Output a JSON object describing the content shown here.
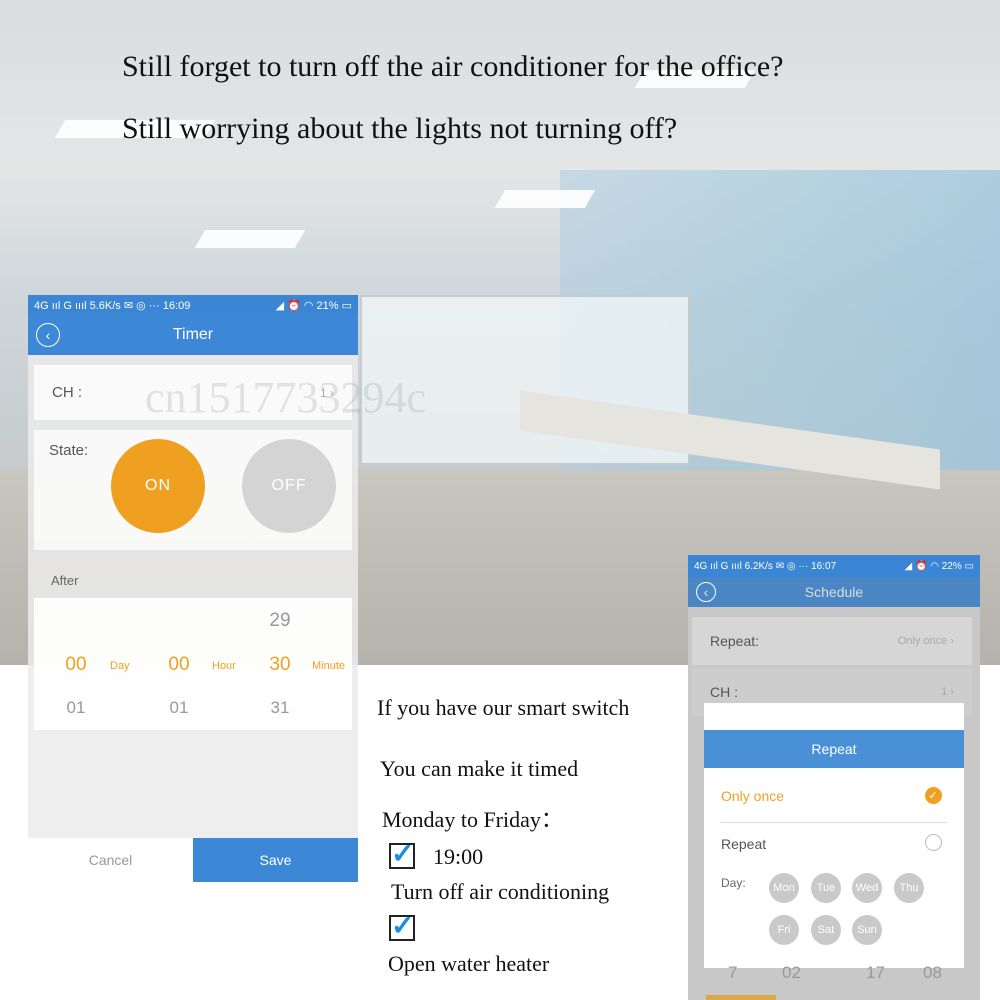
{
  "headlines": [
    "Still forget to turn off the air conditioner for the office?",
    "Still worrying about the lights not turning off?"
  ],
  "watermark": "cn1517733294c",
  "timer_phone": {
    "status": {
      "left": "4G ııl G ıııl 5.6K/s ✉ ◎ ··· 16:09",
      "right": "◢ ⏰ ◠ 21% ▭"
    },
    "title": "Timer",
    "ch_label": "CH :",
    "ch_value": "1 ›",
    "state_label": "State:",
    "on": "ON",
    "off": "OFF",
    "after_label": "After",
    "picker": {
      "top": [
        "",
        "",
        "29"
      ],
      "selected": [
        "00",
        "00",
        "30"
      ],
      "units": [
        "Day",
        "Hour",
        "Minute"
      ],
      "bottom": [
        "01",
        "01",
        "31"
      ]
    },
    "cancel": "Cancel",
    "save": "Save",
    "colors": {
      "blue": "#3d88d6",
      "orange": "#f0a020"
    }
  },
  "middle": {
    "line1": "If you have our smart switch",
    "line2": "You can make it timed",
    "line3": "Monday to Friday：",
    "time": "19:00",
    "action1": "Turn off air conditioning",
    "action2": "Open water heater",
    "check_glyph": "✓"
  },
  "schedule_phone": {
    "status": {
      "left": "4G ııl G ıııl 6.2K/s ✉ ◎ ··· 16:07",
      "right": "◢ ⏰ ◠ 22% ▭"
    },
    "title": "Schedule",
    "repeat_label": "Repeat:",
    "repeat_value": "Only once ›",
    "ch_label": "CH :",
    "ch_value": "1 ›",
    "close_icon": "⊗",
    "modal": {
      "title": "Repeat",
      "option1": "Only once",
      "option2": "Repeat",
      "day_label": "Day:",
      "days": [
        "Mon",
        "Tue",
        "Wed",
        "Thu",
        "Fri",
        "Sat",
        "Sun"
      ]
    },
    "below": [
      "7",
      "02",
      "17",
      "08"
    ]
  }
}
